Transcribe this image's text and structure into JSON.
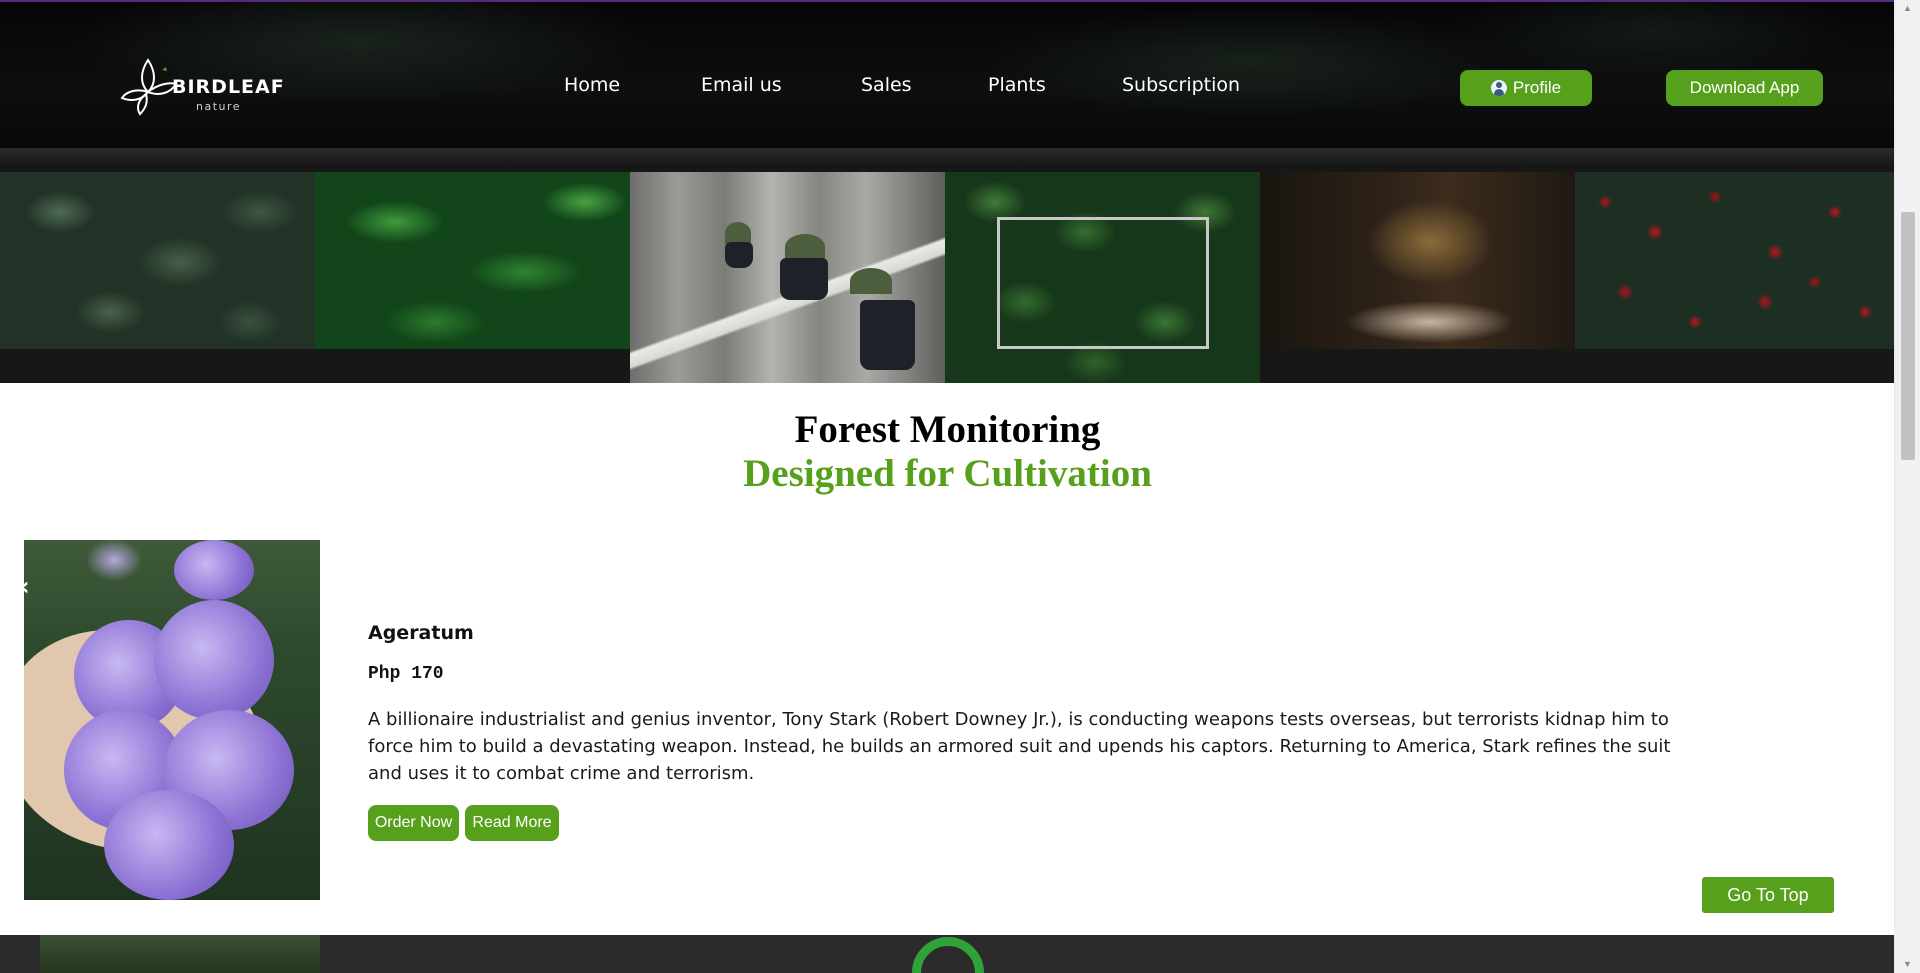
{
  "brand": {
    "name": "BIRDLEAF",
    "tagline": "nature",
    "logo_icon": "leaf-bird-logo"
  },
  "nav": {
    "items": [
      {
        "label": "Home"
      },
      {
        "label": "Email us"
      },
      {
        "label": "Sales"
      },
      {
        "label": "Plants"
      },
      {
        "label": "Subscription"
      }
    ],
    "profile_label": "Profile",
    "profile_icon": "user-icon",
    "download_label": "Download App"
  },
  "gallery": {
    "tiles": [
      "dark-hosta-leaves",
      "green-tropical-leaves",
      "window-shelf-succulents",
      "framed-leaves",
      "potted-succulent",
      "red-roses"
    ]
  },
  "headline": {
    "title": "Forest Monitoring",
    "subtitle": "Designed for Cultivation"
  },
  "product": {
    "name": "Ageratum",
    "price": "Php 170",
    "description": "A billionaire industrialist and genius inventor, Tony Stark (Robert Downey Jr.), is conducting weapons tests overseas, but terrorists kidnap him to force him to build a devastating weapon. Instead, he builds an armored suit and upends his captors. Returning to America, Stark refines the suit and uses it to combat crime and terrorism.",
    "order_label": "Order Now",
    "read_label": "Read More",
    "prev_arrow": "‹"
  },
  "go_top_label": "Go To Top",
  "colors": {
    "accent": "#56a01c",
    "header_bg": "#050505",
    "footer_bg": "#2b2b2b"
  }
}
